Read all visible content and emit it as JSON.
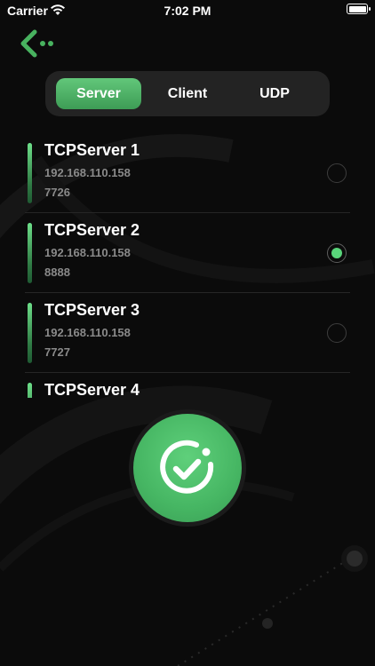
{
  "status_bar": {
    "carrier": "Carrier",
    "time": "7:02 PM"
  },
  "tabs": [
    {
      "label": "Server",
      "active": true
    },
    {
      "label": "Client",
      "active": false
    },
    {
      "label": "UDP",
      "active": false
    }
  ],
  "servers": [
    {
      "name": "TCPServer 1",
      "ip": "192.168.110.158",
      "port": "7726",
      "selected": false
    },
    {
      "name": "TCPServer 2",
      "ip": "192.168.110.158",
      "port": "8888",
      "selected": true
    },
    {
      "name": "TCPServer 3",
      "ip": "192.168.110.158",
      "port": "7727",
      "selected": false
    },
    {
      "name": "TCPServer 4",
      "ip": "",
      "port": "",
      "selected": false
    }
  ],
  "icons": {
    "back": "back-arrow-icon",
    "connect": "check-circle-icon",
    "wifi": "wifi-icon",
    "battery": "battery-icon"
  },
  "colors": {
    "accent": "#59d47a",
    "background": "#0b0b0b",
    "panel": "#232323"
  }
}
